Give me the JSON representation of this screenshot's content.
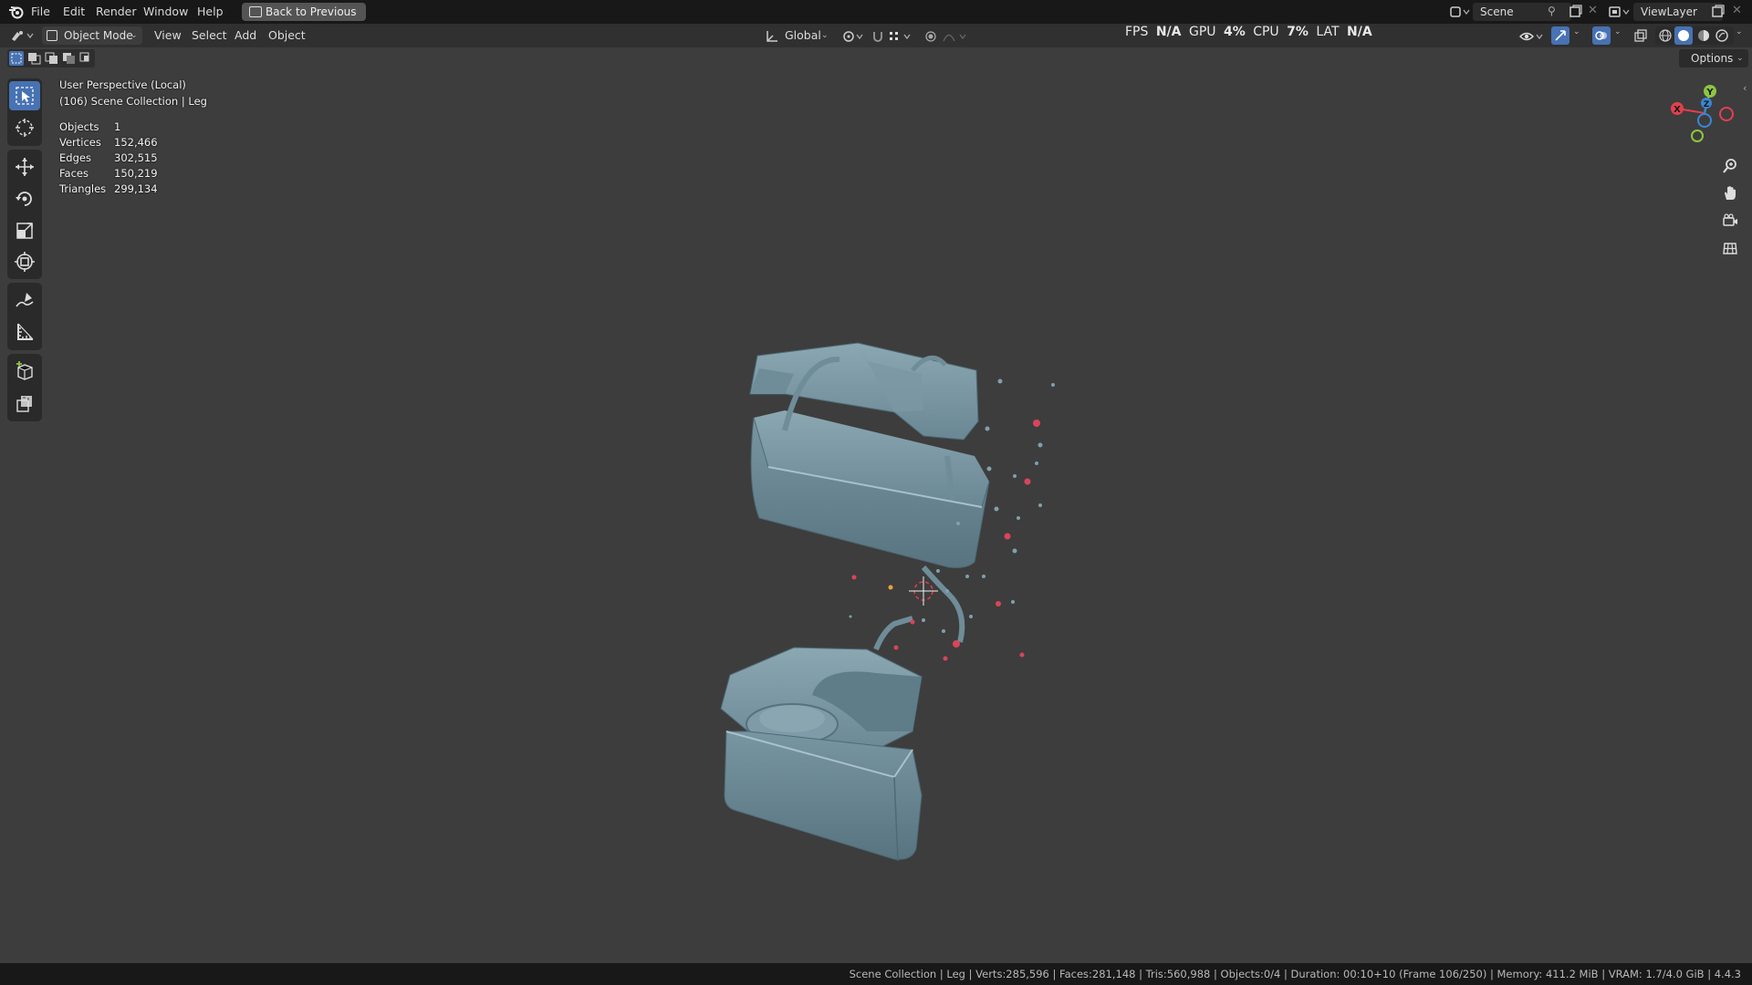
{
  "topbar": {
    "menus": [
      "File",
      "Edit",
      "Render",
      "Window",
      "Help"
    ],
    "back_button": "Back to Previous",
    "scene": "Scene",
    "view_layer": "ViewLayer"
  },
  "header": {
    "mode": "Object Mode",
    "menus": [
      "View",
      "Select",
      "Add",
      "Object"
    ],
    "transform_orientation": "Global",
    "options": "Options"
  },
  "perf": {
    "fps_label": "FPS",
    "fps_value": "N/A",
    "gpu_label": "GPU",
    "gpu_value": "4%",
    "cpu_label": "CPU",
    "cpu_value": "7%",
    "lat_label": "LAT",
    "lat_value": "N/A"
  },
  "overlay": {
    "view_name": "User Perspective (Local)",
    "collection": "(106) Scene Collection | Leg",
    "stats": [
      {
        "label": "Objects",
        "value": "1"
      },
      {
        "label": "Vertices",
        "value": "152,466"
      },
      {
        "label": "Edges",
        "value": "302,515"
      },
      {
        "label": "Faces",
        "value": "150,219"
      },
      {
        "label": "Triangles",
        "value": "299,134"
      }
    ]
  },
  "gizmo": {
    "x": "X",
    "y": "Y",
    "z": "Z"
  },
  "statusbar": {
    "text": "Scene Collection | Leg | Verts:285,596 | Faces:281,148 | Tris:560,988 | Objects:0/4 | Duration: 00:10+10 (Frame 106/250) | Memory: 411.2 MiB | VRAM: 1.7/4.0 GiB | 4.4.3"
  },
  "colors": {
    "accent": "#4772b3",
    "model": "#6f8c99",
    "particles_red": "#d9455a",
    "axis_x": "#e2404f",
    "axis_y": "#8cc63e",
    "axis_z": "#3a86d6"
  },
  "icons": {
    "app": "blender-logo-icon",
    "tools": [
      "select-box-icon",
      "cursor-icon",
      "move-icon",
      "rotate-icon",
      "scale-icon",
      "transform-icon",
      "annotate-icon",
      "measure-icon",
      "add-cube-icon",
      "extrude-icon"
    ],
    "nav": [
      "zoom-icon",
      "pan-hand-icon",
      "camera-icon",
      "grid-ortho-icon"
    ]
  }
}
